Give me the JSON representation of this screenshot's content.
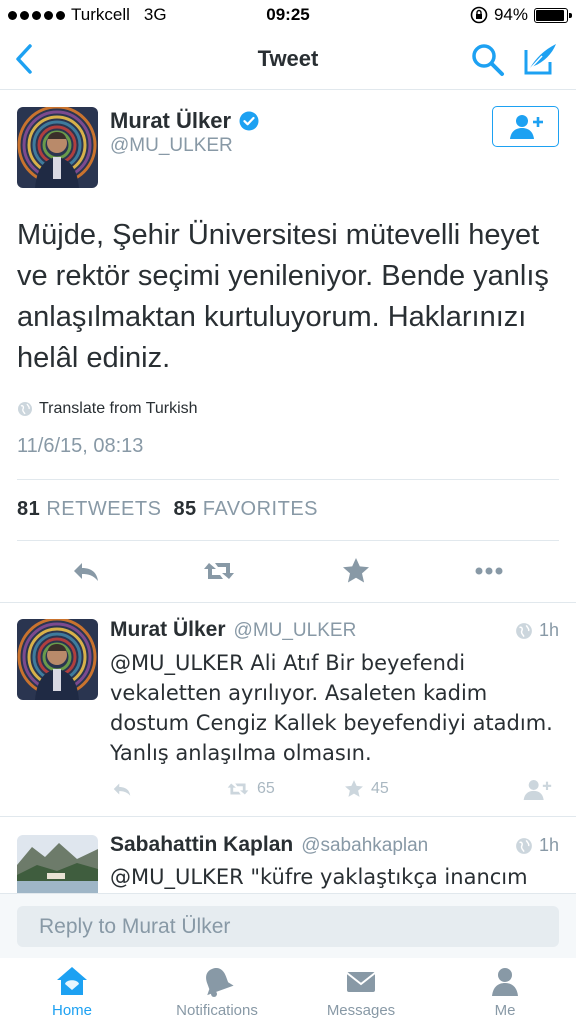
{
  "status_bar": {
    "carrier": "Turkcell",
    "network": "3G",
    "time": "09:25",
    "battery": "94%",
    "battery_level": 0.94
  },
  "nav": {
    "title": "Tweet"
  },
  "main_tweet": {
    "name": "Murat Ülker",
    "handle": "@MU_ULKER",
    "text": "Müjde, Şehir Üniversitesi mütevelli heyet ve rektör seçimi yenileniyor. Bende yanlış anlaşılmaktan kurtuluyorum. Haklarınızı helâl ediniz.",
    "translate": "Translate from Turkish",
    "timestamp": "11/6/15, 08:13",
    "retweets_count": "81",
    "retweets_label": "RETWEETS",
    "favorites_count": "85",
    "favorites_label": "FAVORITES"
  },
  "replies": [
    {
      "name": "Murat Ülker",
      "handle": "@MU_ULKER",
      "time": "1h",
      "text": "@MU_ULKER Ali Atıf Bir beyefendi vekaletten ayrılıyor. Asaleten kadim dostum Cengiz Kallek beyefendiyi atadım. Yanlış anlaşılma olmasın.",
      "retweets": "65",
      "favorites": "45"
    },
    {
      "name": "Sabahattin Kaplan",
      "handle": "@sabahkaplan",
      "time": "1h",
      "text": "@MU_ULKER \"küfre yaklaştıkça inancım"
    }
  ],
  "reply_bar": {
    "placeholder": "Reply to Murat Ülker"
  },
  "tabs": [
    {
      "label": "Home",
      "icon": "home-icon",
      "active": true
    },
    {
      "label": "Notifications",
      "icon": "bell-icon",
      "active": false
    },
    {
      "label": "Messages",
      "icon": "envelope-icon",
      "active": false
    },
    {
      "label": "Me",
      "icon": "person-icon",
      "active": false
    }
  ],
  "colors": {
    "accent": "#1da1f2",
    "text": "#292f33",
    "muted": "#8899a6",
    "divider": "#e1e8ed"
  }
}
